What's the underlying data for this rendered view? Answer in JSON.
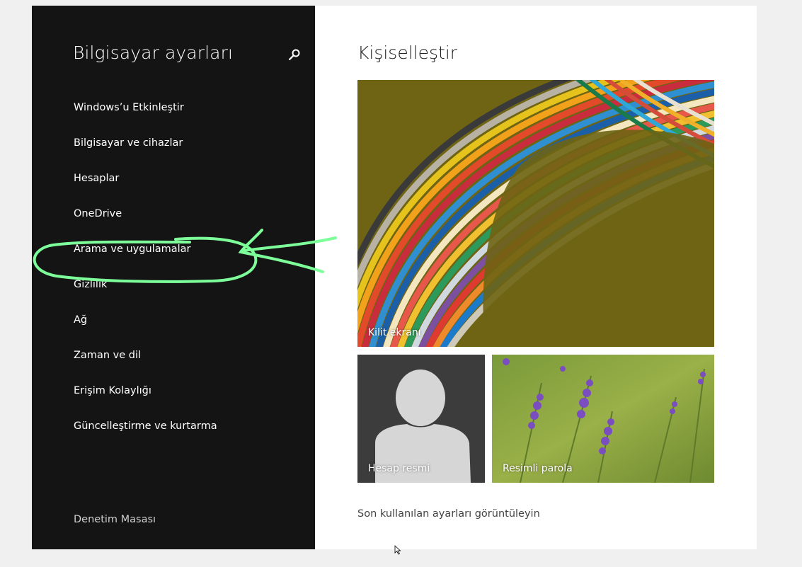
{
  "sidebar": {
    "title": "Bilgisayar ayarları",
    "search_icon": "search-icon",
    "items": [
      {
        "label": "Windows’u Etkinleştir"
      },
      {
        "label": "Bilgisayar ve cihazlar"
      },
      {
        "label": "Hesaplar"
      },
      {
        "label": "OneDrive"
      },
      {
        "label": "Arama ve uygulamalar"
      },
      {
        "label": "Gizlilik"
      },
      {
        "label": "Ağ"
      },
      {
        "label": "Zaman ve dil"
      },
      {
        "label": "Erişim Kolaylığı"
      },
      {
        "label": "Güncelleştirme ve kurtarma"
      }
    ],
    "footer_link": "Denetim Masası"
  },
  "main": {
    "title": "Kişiselleştir",
    "tiles": {
      "lock_screen": "Kilit ekranı",
      "account_picture": "Hesap resmi",
      "picture_password": "Resimli parola"
    },
    "recent_settings_link": "Son kullanılan ayarları görüntüleyin"
  },
  "colors": {
    "sidebar_bg": "#141414",
    "content_bg": "#ffffff",
    "annotation": "#7dff9a"
  }
}
